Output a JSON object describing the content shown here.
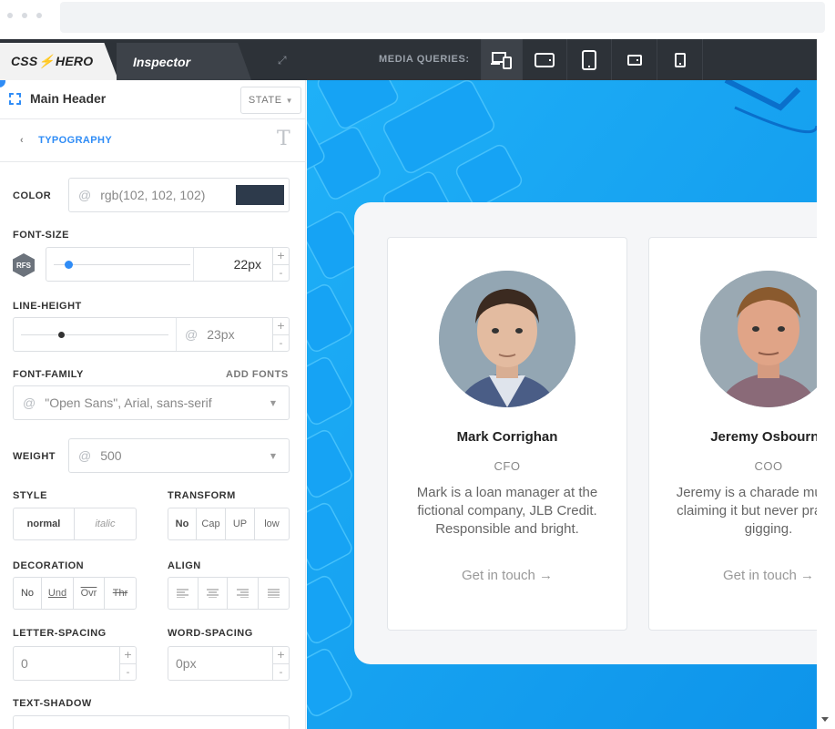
{
  "app": {
    "logo": "CSS HERO",
    "tab_inspector": "Inspector",
    "media_queries_label": "MEDIA QUERIES:",
    "media_queries": [
      "desktop-laptop",
      "tablet-landscape",
      "tablet-portrait",
      "phone-landscape",
      "phone-portrait"
    ]
  },
  "panel": {
    "element_title": "Main Header",
    "state_button": "STATE",
    "section": "TYPOGRAPHY",
    "color": {
      "label": "COLOR",
      "value": "rgb(102, 102, 102)",
      "swatch": "#2d3a4b"
    },
    "font_size": {
      "label": "FONT-SIZE",
      "badge": "RFS",
      "value": "22px",
      "level_percent": 8
    },
    "line_height": {
      "label": "LINE-HEIGHT",
      "value": "23px",
      "level_percent": 25
    },
    "font_family": {
      "label": "FONT-FAMILY",
      "add_fonts": "ADD FONTS",
      "value": "\"Open Sans\", Arial, sans-serif"
    },
    "weight": {
      "label": "WEIGHT",
      "value": "500"
    },
    "style": {
      "label": "STYLE",
      "options": [
        "normal",
        "italic"
      ]
    },
    "transform": {
      "label": "TRANSFORM",
      "options": [
        "No",
        "Cap",
        "UP",
        "low"
      ]
    },
    "decoration": {
      "label": "DECORATION",
      "options": [
        "No",
        "Und",
        "Ovr",
        "Thr"
      ]
    },
    "align": {
      "label": "ALIGN",
      "options": [
        "left",
        "center",
        "right",
        "justify"
      ]
    },
    "letter_spacing": {
      "label": "LETTER-SPACING",
      "value": "0"
    },
    "word_spacing": {
      "label": "WORD-SPACING",
      "value": "0px"
    },
    "text_shadow": {
      "label": "TEXT-SHADOW"
    }
  },
  "preview": {
    "cards": [
      {
        "name": "Mark Corrighan",
        "role": "CFO",
        "bio": "Mark is a loan manager at the fictional company, JLB Credit. Responsible and bright.",
        "cta": "Get in touch →"
      },
      {
        "name": "Jeremy Osbourne",
        "role": "COO",
        "bio": "Jeremy is a charade musician, claiming it but never practicing gigging.",
        "cta": "Get in touch →"
      }
    ]
  }
}
